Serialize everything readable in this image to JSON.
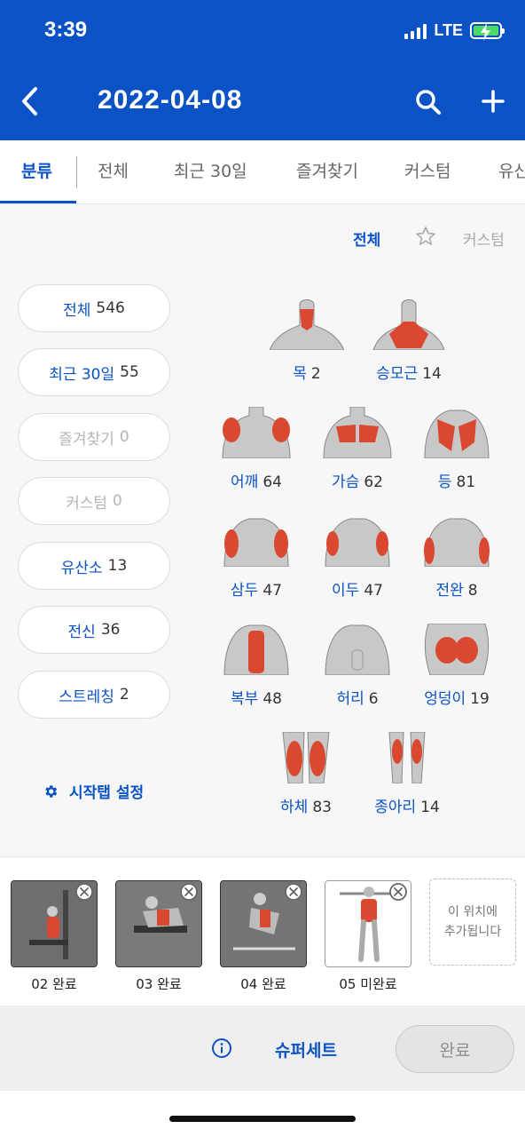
{
  "status_bar": {
    "time": "3:39",
    "network": "LTE"
  },
  "header": {
    "title": "2022-04-08",
    "back_icon": "chevron-left-icon",
    "search_icon": "search-icon",
    "add_icon": "plus-icon"
  },
  "tabs": [
    {
      "label": "분류",
      "active": true
    },
    {
      "label": "전체"
    },
    {
      "label": "최근 30일"
    },
    {
      "label": "즐겨찾기"
    },
    {
      "label": "커스텀"
    },
    {
      "label": "유산"
    }
  ],
  "filter": {
    "all_label": "전체",
    "star_icon": "star-icon",
    "custom_label": "커스텀"
  },
  "categories": [
    {
      "label": "전체",
      "count": "546"
    },
    {
      "label": "최근 30일",
      "count": "55"
    },
    {
      "label": "즐겨찾기",
      "count": "0",
      "disabled": true
    },
    {
      "label": "커스텀",
      "count": "0",
      "disabled": true
    },
    {
      "label": "유산소",
      "count": "13"
    },
    {
      "label": "전신",
      "count": "36"
    },
    {
      "label": "스트레칭",
      "count": "2"
    }
  ],
  "settings": {
    "label": "시작탭 설정",
    "icon": "gear-icon"
  },
  "muscles": [
    {
      "label": "목",
      "count": "2"
    },
    {
      "label": "승모근",
      "count": "14"
    },
    {
      "label": "어깨",
      "count": "64"
    },
    {
      "label": "가슴",
      "count": "62"
    },
    {
      "label": "등",
      "count": "81"
    },
    {
      "label": "삼두",
      "count": "47"
    },
    {
      "label": "이두",
      "count": "47"
    },
    {
      "label": "전완",
      "count": "8"
    },
    {
      "label": "복부",
      "count": "48"
    },
    {
      "label": "허리",
      "count": "6"
    },
    {
      "label": "엉덩이",
      "count": "19"
    },
    {
      "label": "하체",
      "count": "83"
    },
    {
      "label": "종아리",
      "count": "14"
    }
  ],
  "selected": [
    {
      "label": "02 완료"
    },
    {
      "label": "03 완료"
    },
    {
      "label": "04 완료"
    },
    {
      "label": "05 미완료"
    }
  ],
  "placeholder": {
    "line1": "이 위치에",
    "line2": "추가됩니다"
  },
  "bottom": {
    "info_icon": "info-icon",
    "superset_label": "슈퍼세트",
    "done_label": "완료"
  },
  "colors": {
    "primary": "#0a52c6",
    "muscle_highlight": "#d9482f"
  }
}
